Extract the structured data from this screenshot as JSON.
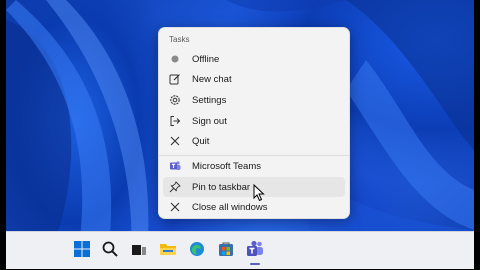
{
  "jumplist": {
    "section_title": "Tasks",
    "tasks": [
      {
        "label": "Offline",
        "icon": "status-dot-icon"
      },
      {
        "label": "New chat",
        "icon": "compose-icon"
      },
      {
        "label": "Settings",
        "icon": "gear-icon"
      },
      {
        "label": "Sign out",
        "icon": "sign-out-icon"
      },
      {
        "label": "Quit",
        "icon": "close-icon"
      }
    ],
    "app_items": [
      {
        "label": "Microsoft Teams",
        "icon": "teams-icon"
      },
      {
        "label": "Pin to taskbar",
        "icon": "pin-icon"
      },
      {
        "label": "Close all windows",
        "icon": "close-icon"
      }
    ]
  },
  "taskbar": {
    "icons": [
      "windows-start-icon",
      "search-icon",
      "task-view-icon",
      "file-explorer-icon",
      "edge-icon",
      "store-icon",
      "teams-icon"
    ]
  },
  "colors": {
    "accent": "#2b6af0",
    "teams": "#5b5fc7",
    "menu_bg": "#f3f3f3"
  }
}
